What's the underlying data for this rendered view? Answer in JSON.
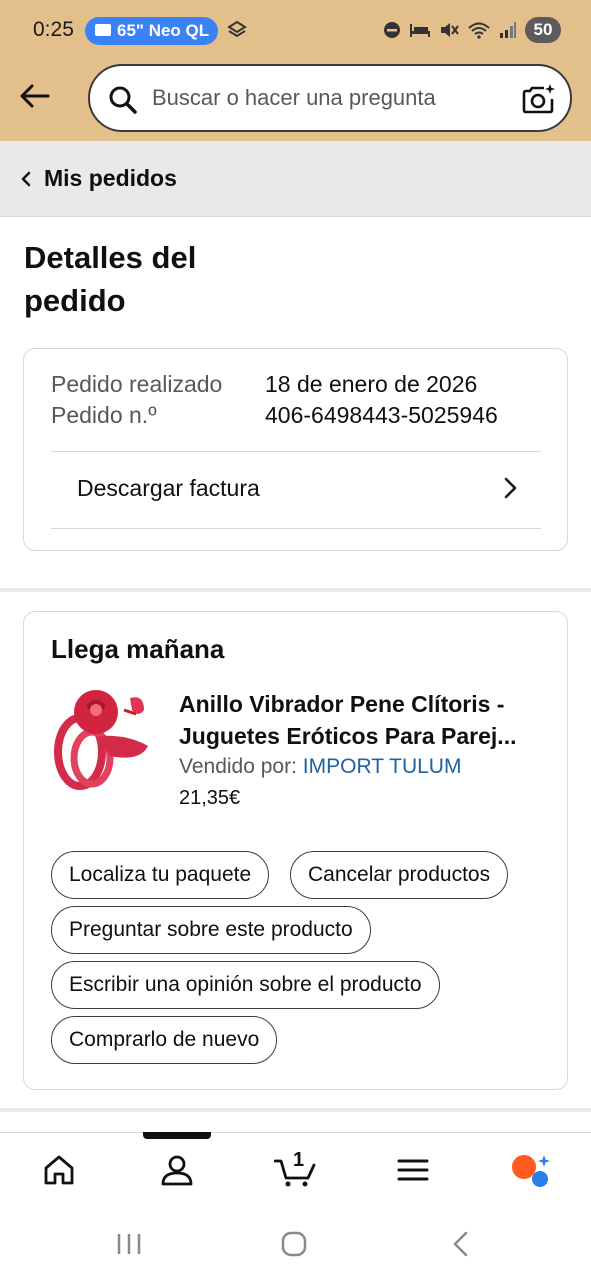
{
  "status_bar": {
    "time": "0:25",
    "cast_label": "65\" Neo QL",
    "battery": "50"
  },
  "search": {
    "placeholder": "Buscar o hacer una pregunta"
  },
  "breadcrumb": {
    "label": "Mis pedidos"
  },
  "page": {
    "title_line1": "Detalles del",
    "title_line2": "pedido"
  },
  "order_summary": {
    "placed_label": "Pedido realizado",
    "placed_value": "18 de enero de 2026",
    "number_label": "Pedido n.º",
    "number_value": "406-6498443-5025946",
    "invoice_link": "Descargar factura"
  },
  "shipment": {
    "status": "Llega mañana",
    "product": {
      "title_line1": "Anillo Vibrador Pene Clítoris -",
      "title_line2": "Juguetes Eróticos Para Parej...",
      "sold_by_label": "Vendido por:",
      "seller": "IMPORT TULUM",
      "price": "21,35€"
    },
    "actions": {
      "track": "Localiza tu paquete",
      "cancel": "Cancelar productos",
      "ask": "Preguntar sobre este producto",
      "review": "Escribir una opinión sobre el producto",
      "buy_again": "Comprarlo de nuevo"
    }
  },
  "bottom_nav": {
    "cart_count": "1",
    "items": [
      "home-icon",
      "account-icon",
      "cart-icon",
      "menu-icon",
      "rufus-icon"
    ]
  },
  "colors": {
    "header": "#e3bf8c",
    "link": "#2162a1",
    "breadcrumb_bg": "#e7e9ea"
  }
}
